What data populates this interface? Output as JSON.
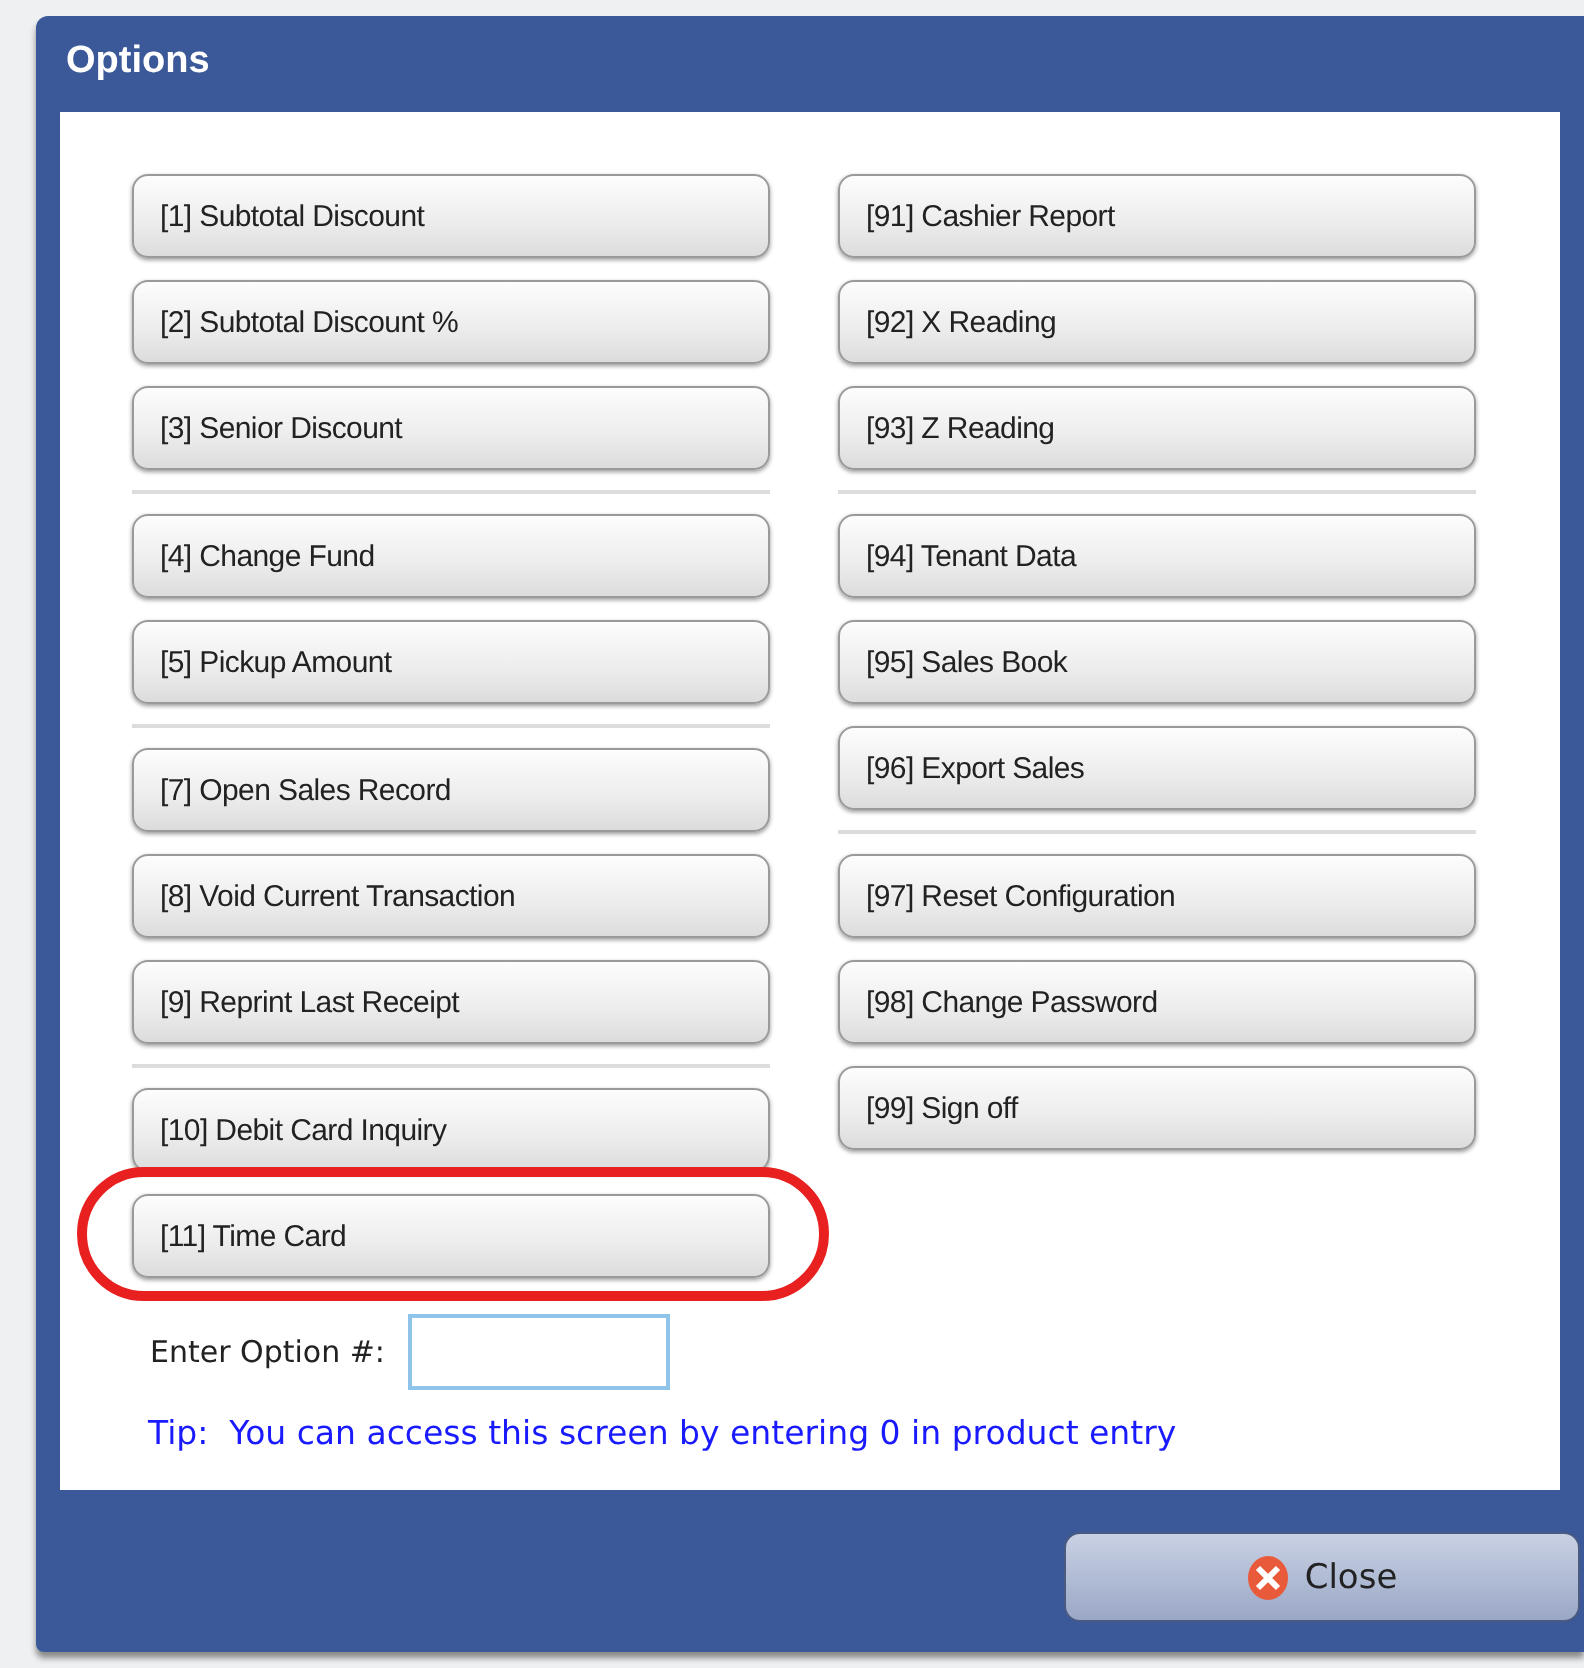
{
  "window": {
    "title": "Options"
  },
  "columns": [
    {
      "groups": [
        {
          "buttons": [
            {
              "label": "[1] Subtotal Discount",
              "highlighted": false
            },
            {
              "label": "[2] Subtotal Discount %",
              "highlighted": false
            },
            {
              "label": "[3] Senior Discount",
              "highlighted": false
            }
          ]
        },
        {
          "buttons": [
            {
              "label": "[4] Change Fund",
              "highlighted": false
            },
            {
              "label": "[5] Pickup Amount",
              "highlighted": false
            }
          ]
        },
        {
          "buttons": [
            {
              "label": "[7] Open Sales Record",
              "highlighted": false
            },
            {
              "label": "[8] Void Current Transaction",
              "highlighted": false
            },
            {
              "label": "[9] Reprint Last Receipt",
              "highlighted": false
            }
          ]
        },
        {
          "buttons": [
            {
              "label": "[10] Debit Card Inquiry",
              "highlighted": false
            },
            {
              "label": "[11] Time Card",
              "highlighted": true
            }
          ]
        }
      ]
    },
    {
      "groups": [
        {
          "buttons": [
            {
              "label": "[91] Cashier Report",
              "highlighted": false
            },
            {
              "label": "[92] X Reading",
              "highlighted": false
            },
            {
              "label": "[93] Z Reading",
              "highlighted": false
            }
          ]
        },
        {
          "buttons": [
            {
              "label": "[94] Tenant Data",
              "highlighted": false
            },
            {
              "label": "[95] Sales Book",
              "highlighted": false
            },
            {
              "label": "[96] Export Sales",
              "highlighted": false
            }
          ]
        },
        {
          "buttons": [
            {
              "label": "[97] Reset Configuration",
              "highlighted": false
            },
            {
              "label": "[98] Change Password",
              "highlighted": false
            },
            {
              "label": "[99] Sign off",
              "highlighted": false
            }
          ]
        }
      ]
    }
  ],
  "option_entry": {
    "label": "Enter Option #:"
  },
  "tip": "Tip:  You can access this screen by entering 0 in product entry",
  "close_button": {
    "label": "Close"
  }
}
